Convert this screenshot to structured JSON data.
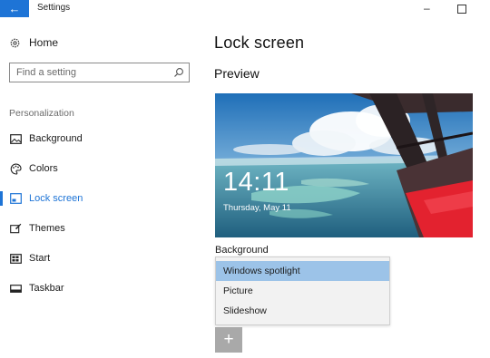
{
  "window": {
    "title": "Settings",
    "back_icon": "back-arrow-icon",
    "accent": "#1e74d6"
  },
  "sidebar": {
    "home_label": "Home",
    "search_placeholder": "Find a setting",
    "section_label": "Personalization",
    "items": [
      {
        "label": "Background",
        "icon": "picture-icon"
      },
      {
        "label": "Colors",
        "icon": "palette-icon"
      },
      {
        "label": "Lock screen",
        "icon": "lock-screen-icon",
        "active": true
      },
      {
        "label": "Themes",
        "icon": "brush-icon"
      },
      {
        "label": "Start",
        "icon": "start-grid-icon"
      },
      {
        "label": "Taskbar",
        "icon": "taskbar-icon"
      }
    ]
  },
  "main": {
    "title": "Lock screen",
    "preview_title": "Preview",
    "preview": {
      "time": "14:11",
      "date": "Thursday, May 11"
    },
    "background_label": "Background",
    "background_options": [
      {
        "label": "Windows spotlight",
        "selected": true
      },
      {
        "label": "Picture"
      },
      {
        "label": "Slideshow"
      }
    ],
    "add_icon": "plus-icon"
  }
}
